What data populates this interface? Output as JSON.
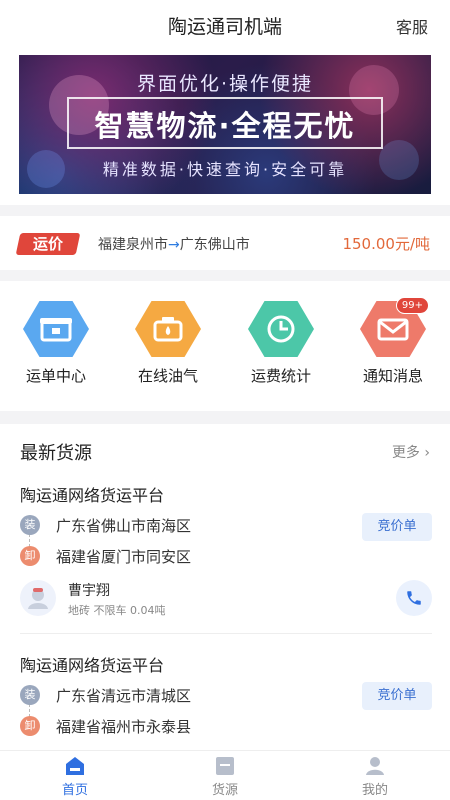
{
  "header": {
    "title": "陶运通司机端",
    "service": "客服"
  },
  "banner": {
    "line1": "界面优化·操作便捷",
    "line2": "智慧物流·全程无忧",
    "line3": "精准数据·快速查询·安全可靠"
  },
  "freight": {
    "tag": "运价",
    "from": "福建泉州市",
    "arrow": "→",
    "to": "广东佛山市",
    "price": "150.00元/吨"
  },
  "menu": [
    {
      "label": "运单中心",
      "icon": "waybill-icon",
      "color": "#5aa8f0"
    },
    {
      "label": "在线油气",
      "icon": "fuel-icon",
      "color": "#f5a942"
    },
    {
      "label": "运费统计",
      "icon": "chart-clock-icon",
      "color": "#4cc7a8"
    },
    {
      "label": "通知消息",
      "icon": "mail-icon",
      "color": "#ee7a6a",
      "badge": "99+"
    }
  ],
  "cargo": {
    "title": "最新货源",
    "more": "更多",
    "load_tag": "装",
    "unload_tag": "卸",
    "items": [
      {
        "platform": "陶运通网络货运平台",
        "load": "广东省佛山市南海区",
        "unload": "福建省厦门市同安区",
        "button": "竞价单",
        "driver": "曹宇翔",
        "meta": "地砖  不限车  0.04吨"
      },
      {
        "platform": "陶运通网络货运平台",
        "load": "广东省清远市清城区",
        "unload": "福建省福州市永泰县",
        "button": "竞价单"
      }
    ]
  },
  "tabbar": [
    {
      "label": "首页",
      "icon": "home-icon",
      "active": true
    },
    {
      "label": "货源",
      "icon": "cargo-icon",
      "active": false
    },
    {
      "label": "我的",
      "icon": "user-icon",
      "active": false
    }
  ],
  "colors": {
    "accent": "#2f6fe0",
    "price": "#e2683a",
    "tag_red": "#e0463b",
    "load": "#9aa7bd",
    "unload": "#ec8c6e"
  }
}
